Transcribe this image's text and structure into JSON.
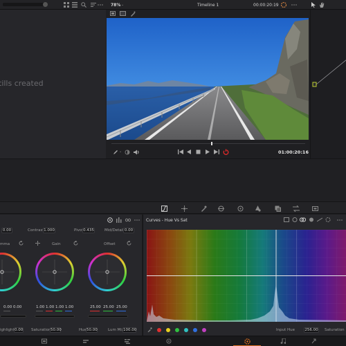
{
  "topbar": {
    "zoom": "78%",
    "timeline": "Timeline 1",
    "timecode": "00:00:20:19"
  },
  "gallery": {
    "empty_text": "tills created"
  },
  "viewer": {
    "timecode": "01:00:20:16"
  },
  "wheels_panel": {
    "top_params": [
      {
        "label": "",
        "value": "0.00"
      },
      {
        "label": "Contrast",
        "value": "1.000"
      },
      {
        "label": "Pivot",
        "value": "0.435"
      },
      {
        "label": "Mid/Detail",
        "value": "0.00"
      }
    ],
    "wheel_titles": [
      "mma",
      "Gain",
      "Offset"
    ],
    "lift_values": [
      "0.00",
      "0.00"
    ],
    "gain_values": [
      "1.00",
      "1.00",
      "1.00",
      "1.00"
    ],
    "offset_values": [
      "25.00",
      "25.00",
      "25.00"
    ],
    "bottom_params": [
      {
        "label": "ighlights",
        "value": "0.00"
      },
      {
        "label": "Saturation",
        "value": "50.00"
      },
      {
        "label": "Hue",
        "value": "50.00"
      },
      {
        "label": "Lum Mix",
        "value": "100.00"
      }
    ]
  },
  "curves_panel": {
    "title": "Curves - Hue Vs Sat",
    "input_hue_label": "Input Hue",
    "input_hue_value": "256.00",
    "saturation_label": "Saturation",
    "dot_colors": [
      "#e03030",
      "#e8d020",
      "#30c040",
      "#30c0c0",
      "#3070e0",
      "#c040c0"
    ]
  },
  "icons": {
    "viewer_controls": [
      "first-frame-icon",
      "prev-frame-icon",
      "stop-icon",
      "play-icon",
      "next-frame-icon",
      "last-frame-icon",
      "loop-icon"
    ],
    "toolbar2": [
      "curves-icon",
      "warper-icon",
      "qualifier-icon",
      "window-icon",
      "tracker-icon",
      "blur-icon",
      "key-icon",
      "sizing-icon",
      "3d-icon"
    ],
    "pages": [
      "media-icon",
      "cut-icon",
      "edit-icon",
      "fusion-icon",
      "color-icon",
      "fairlight-icon",
      "deliver-icon"
    ]
  }
}
